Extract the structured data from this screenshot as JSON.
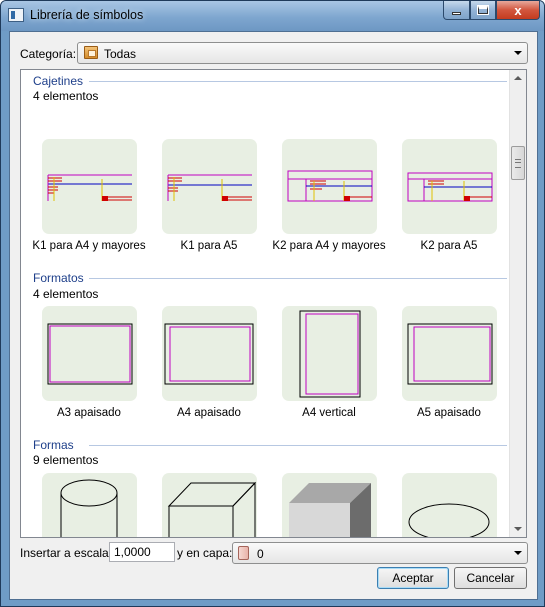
{
  "window": {
    "title": "Librería de símbolos",
    "minimize_label": "",
    "maximize_label": "",
    "close_label": "x"
  },
  "category": {
    "label": "Categoría:",
    "value": "Todas"
  },
  "sections": [
    {
      "title": "Cajetines",
      "count": "4 elementos",
      "items": [
        {
          "label": "K1 para A4 y mayores"
        },
        {
          "label": "K1 para A5"
        },
        {
          "label": "K2 para A4 y mayores"
        },
        {
          "label": "K2 para A5"
        }
      ]
    },
    {
      "title": "Formatos",
      "count": "4 elementos",
      "items": [
        {
          "label": "A3 apaisado"
        },
        {
          "label": "A4 apaisado"
        },
        {
          "label": "A4 vertical"
        },
        {
          "label": "A5 apaisado"
        }
      ]
    },
    {
      "title": "Formas",
      "count": "9 elementos",
      "items": [
        {
          "label": ""
        },
        {
          "label": ""
        },
        {
          "label": ""
        },
        {
          "label": ""
        }
      ]
    }
  ],
  "footer": {
    "scale_label": "Insertar a escala:",
    "scale_value": "1,0000",
    "layer_label": "y en capa:",
    "layer_value": "0",
    "accept_label": "Aceptar",
    "cancel_label": "Cancelar"
  },
  "colors": {
    "accent": "#1e3f8a",
    "tile_bg": "#e8efe3",
    "magenta": "#c000c0",
    "red": "#d00000",
    "blue": "#0000c0",
    "yellow": "#e0c000"
  }
}
